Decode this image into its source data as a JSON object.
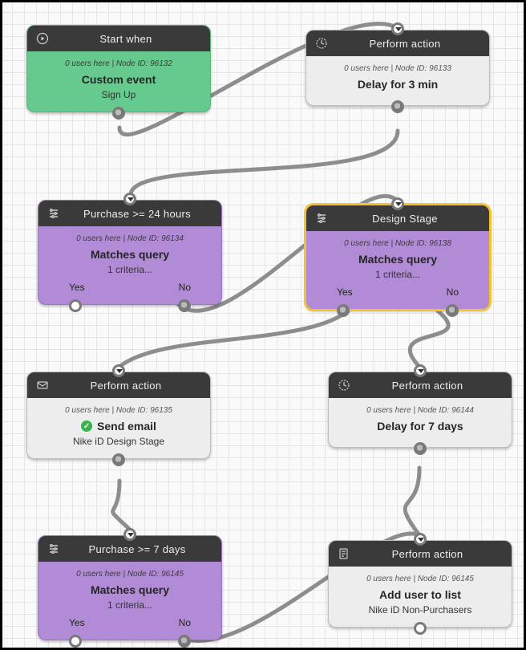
{
  "nodes": {
    "start": {
      "header": "Start when",
      "meta": "0 users here | Node ID: 96132",
      "title": "Custom event",
      "sub": "Sign Up"
    },
    "delay3": {
      "header": "Perform action",
      "meta": "0 users here | Node ID: 96133",
      "title": "Delay for 3 min",
      "sub": ""
    },
    "purchase24": {
      "header": "Purchase >= 24 hours",
      "meta": "0 users here | Node ID: 96134",
      "title": "Matches query",
      "sub": "1 criteria...",
      "yes": "Yes",
      "no": "No"
    },
    "designStage": {
      "header": "Design Stage",
      "meta": "0 users here | Node ID: 96138",
      "title": "Matches query",
      "sub": "1 criteria...",
      "yes": "Yes",
      "no": "No"
    },
    "sendEmail": {
      "header": "Perform action",
      "meta": "0 users here | Node ID: 96135",
      "title": "Send email",
      "sub": "Nike iD Design Stage"
    },
    "delay7": {
      "header": "Perform action",
      "meta": "0 users here | Node ID: 96144",
      "title": "Delay for 7 days",
      "sub": ""
    },
    "purchase7d": {
      "header": "Purchase >= 7 days",
      "meta": "0 users here | Node ID: 96145",
      "title": "Matches query",
      "sub": "1 criteria...",
      "yes": "Yes",
      "no": "No"
    },
    "addList": {
      "header": "Perform action",
      "meta": "0 users here | Node ID: 96145",
      "title": "Add user to list",
      "sub": "Nike iD Non-Purchasers"
    }
  }
}
